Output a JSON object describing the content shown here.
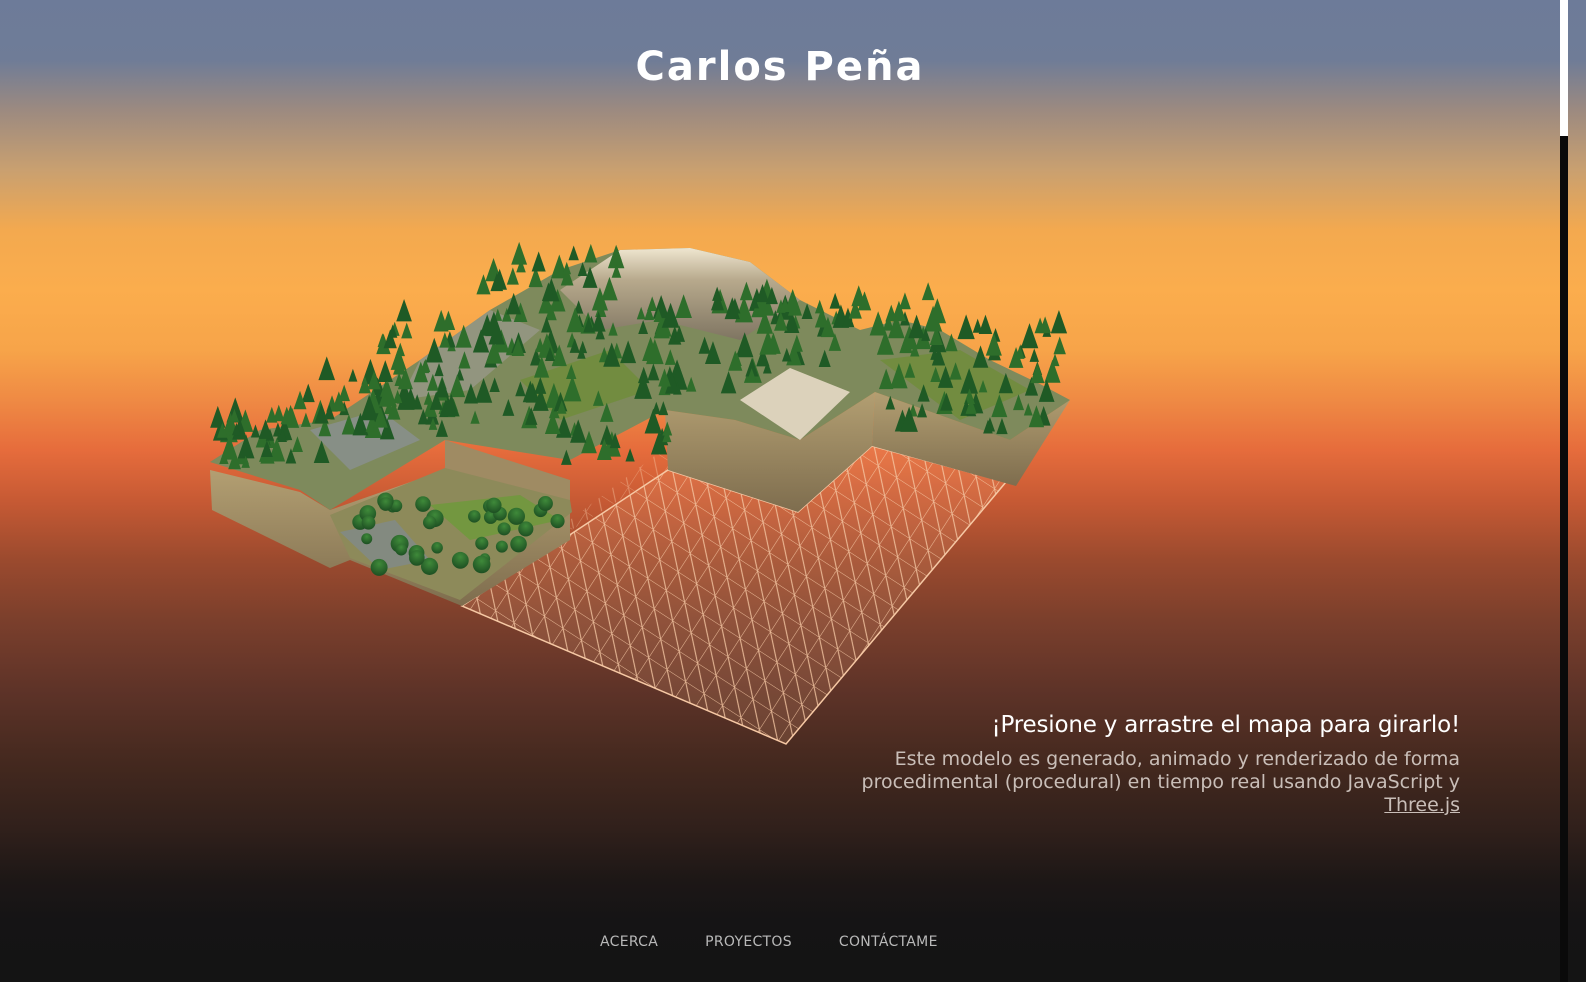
{
  "header": {
    "title": "Carlos Peña"
  },
  "map": {
    "name": "3d-terrain-map"
  },
  "info": {
    "heading": "¡Presione y arrastre el mapa para girarlo!",
    "description": "Este modelo es generado, animado y renderizado de forma procedimental (procedural) en tiempo real usando JavaScript y",
    "link_text": "Three.js"
  },
  "nav": {
    "items": [
      {
        "label": "ACERCA"
      },
      {
        "label": "PROYECTOS"
      },
      {
        "label": "CONTÁCTAME"
      }
    ]
  },
  "colors": {
    "sky_top": "#6d7b99",
    "sky_mid": "#fbad4d",
    "horizon": "#e66c3c",
    "ground": "#141414",
    "grid_line": "#f7c7a0",
    "terrain_side": "#a8956c"
  }
}
